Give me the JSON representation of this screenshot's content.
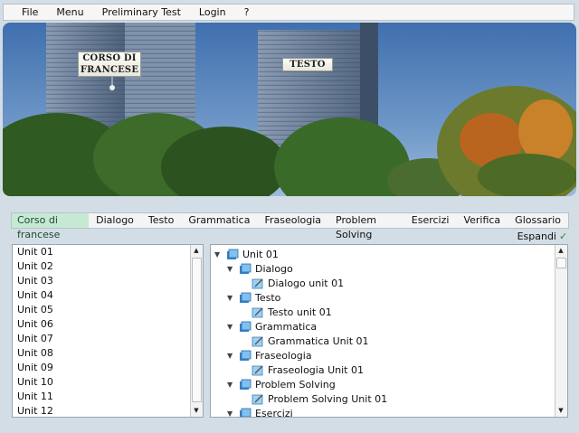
{
  "menu": [
    "File",
    "Menu",
    "Preliminary Test",
    "Login",
    "?"
  ],
  "banner": {
    "sign1": "CORSO DI FRANCESE",
    "sign2": "TESTO"
  },
  "tabs": [
    "Corso di francese",
    "Dialogo",
    "Testo",
    "Grammatica",
    "Fraseologia",
    "Problem Solving",
    "Esercizi",
    "Verifica",
    "Glossario"
  ],
  "expand": {
    "label": "Espandi",
    "checked": true
  },
  "units": [
    "Unit 01",
    "Unit 02",
    "Unit 03",
    "Unit 04",
    "Unit 05",
    "Unit 06",
    "Unit 07",
    "Unit 08",
    "Unit 09",
    "Unit 10",
    "Unit 11",
    "Unit 12"
  ],
  "tree": {
    "root": "Unit 01",
    "children": [
      {
        "label": "Dialogo",
        "leaf": "Dialogo unit 01"
      },
      {
        "label": "Testo",
        "leaf": "Testo unit 01"
      },
      {
        "label": "Grammatica",
        "leaf": "Grammatica Unit 01"
      },
      {
        "label": "Fraseologia",
        "leaf": "Fraseologia Unit 01"
      },
      {
        "label": "Problem Solving",
        "leaf": "Problem Solving Unit 01"
      },
      {
        "label": "Esercizi",
        "leaf": ""
      }
    ]
  }
}
